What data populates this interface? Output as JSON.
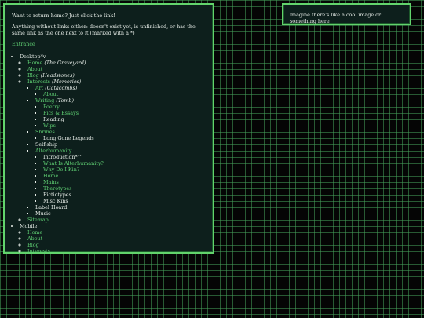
{
  "intro": {
    "line1": "Want to return home? Just click the link!",
    "line2": "Anything without links either: doesn't exist yet, is unfinished, or has the same link as the one next to it (marked with a *)"
  },
  "entrance_label": "Entrance",
  "desktop": {
    "label": "Desktop*v",
    "home": "Home",
    "home_note": "(The Graveyard)",
    "about": "About",
    "blog": "Blog",
    "blog_note": "(Headstones)",
    "interests": "Interests",
    "interests_note": "(Memories)",
    "art": "Art",
    "art_note": "(Catacombs)",
    "art_about": "About",
    "writing": "Writing",
    "writing_note": "(Tomb)",
    "writing_items": [
      "Poetry",
      "Fics & Essays",
      "Reading",
      "Wips"
    ],
    "shrines": "Shrines",
    "shrine_items": [
      "Long Gone Legends"
    ],
    "selfship": "Self-ship",
    "alterhumanity": "Alterhumanity",
    "alter_items": [
      "Introduction*^",
      "What Is Alterhumanity?",
      "Why Do I Kin?",
      "Home",
      "Mains",
      "Therotypes",
      "Fictiotypes",
      "Misc Kins"
    ],
    "label_hoard": "Label Hoard",
    "music": "Music",
    "sitemap": "Sitemap"
  },
  "mobile": {
    "label": "Mobile",
    "items": [
      "Home",
      "About",
      "Blog",
      "Interests"
    ]
  },
  "image_placeholder": "imagine there's like a cool image or something here",
  "colors": {
    "panel_bg": "#0d1f1c",
    "border": "#62d36c",
    "link": "#5fcf73",
    "text": "#e7ede8",
    "grid": "#46a05a"
  }
}
